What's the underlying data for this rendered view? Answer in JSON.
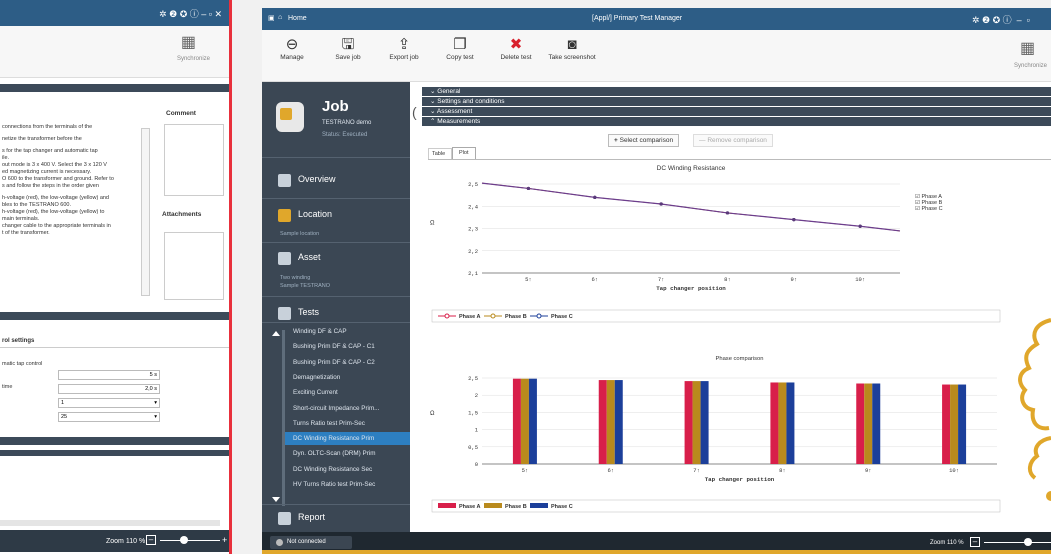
{
  "left": {
    "synchronize": "Synchronize",
    "comment": "Comment",
    "attachments": "Attachments",
    "instructions": [
      "connections from the terminals of the",
      "",
      "netize the transformer before the",
      "",
      "s for the tap changer and automatic tap",
      "ile.",
      "out mode is 3 x 400 V. Select the 3 x 120 V",
      "ed magnetizing current is necessary.",
      "O 600 to the transformer and ground. Refer to",
      "s and follow the steps in the order given",
      "",
      "h-voltage (red), the low-voltage (yellow) and",
      "bles to the TESTRANO 600.",
      "h-voltage (red), the low-voltage (yellow) to",
      "main terminals.",
      "changer cable to the appropriate terminals in",
      "t of the transformer."
    ],
    "control_title": "rol settings",
    "matic_label": "matic tap control",
    "time_label": "time",
    "values": [
      "5 s",
      "2,0 s",
      "1",
      "25"
    ],
    "zoom": "Zoom  110 %"
  },
  "right": {
    "home": "Home",
    "app_title": "[Appl/] Primary Test Manager",
    "toolbar": [
      {
        "label": "Manage",
        "icon": "arrow-left-icon"
      },
      {
        "label": "Save job",
        "icon": "save-icon"
      },
      {
        "label": "Export job",
        "icon": "export-icon"
      },
      {
        "label": "Copy test",
        "icon": "copy-icon"
      },
      {
        "label": "Delete test",
        "icon": "delete-icon"
      },
      {
        "label": "Take screenshot",
        "icon": "camera-icon"
      }
    ],
    "synchronize": "Synchronize",
    "job": {
      "title": "Job",
      "device": "TESTRANO demo",
      "status": "Status: Executed"
    },
    "nav": {
      "overview": "Overview",
      "location": "Location",
      "location_sub": "Sample location",
      "asset": "Asset",
      "asset_sub1": "Two winding",
      "asset_sub2": "Sample TESTRANO",
      "tests": "Tests",
      "report": "Report"
    },
    "tests": [
      "Winding DF & CAP",
      "Bushing Prim DF & CAP - C1",
      "Bushing Prim DF & CAP - C2",
      "Demagnetization",
      "Exciting Current",
      "Short-circuit Impedance Prim...",
      "Turns Ratio test Prim-Sec",
      "DC Winding Resistance Prim",
      "Dyn. OLTC-Scan (DRM) Prim",
      "DC Winding Resistance Sec",
      "HV Turns Ratio test Prim-Sec"
    ],
    "selected_test": "DC Winding Resistance Prim",
    "sections": [
      "General",
      "Settings and conditions",
      "Assessment",
      "Measurements"
    ],
    "buttons": {
      "select": "Select comparison",
      "remove": "Remove comparison"
    },
    "tabs": [
      "Table",
      "Plot"
    ],
    "checkboxes": [
      "Phase A",
      "Phase B",
      "Phase C"
    ],
    "not_connected": "Not connected",
    "zoom": "Zoom  110 %"
  },
  "colors": {
    "phase_a": "#d81f4a",
    "phase_b": "#b98a1d",
    "phase_c": "#1c3f9a",
    "accent_bar": "#e0a72b"
  },
  "chart_data": [
    {
      "type": "line",
      "title": "DC Winding Resistance",
      "xlabel": "Tap changer position",
      "ylabel": "Ω",
      "categories": [
        "5↑",
        "6↑",
        "7↑",
        "8↑",
        "9↑",
        "10↑"
      ],
      "ylim": [
        2.1,
        2.5
      ],
      "yticks": [
        "2,1",
        "2,2",
        "2,3",
        "2,4",
        "2,5"
      ],
      "series": [
        {
          "name": "Phase A",
          "values": [
            2.48,
            2.44,
            2.41,
            2.37,
            2.34,
            2.31
          ]
        },
        {
          "name": "Phase B",
          "values": [
            2.48,
            2.44,
            2.41,
            2.37,
            2.34,
            2.31
          ]
        },
        {
          "name": "Phase C",
          "values": [
            2.48,
            2.44,
            2.41,
            2.37,
            2.34,
            2.31
          ]
        }
      ]
    },
    {
      "type": "bar",
      "title": "Phase comparison",
      "xlabel": "Tap changer position",
      "ylabel": "Ω",
      "categories": [
        "5↑",
        "6↑",
        "7↑",
        "8↑",
        "9↑",
        "10↑"
      ],
      "ylim": [
        0,
        2.5
      ],
      "yticks": [
        "0",
        "0,5",
        "1",
        "1,5",
        "2",
        "2,5"
      ],
      "series": [
        {
          "name": "Phase A",
          "values": [
            2.48,
            2.44,
            2.41,
            2.37,
            2.34,
            2.31
          ]
        },
        {
          "name": "Phase B",
          "values": [
            2.48,
            2.44,
            2.41,
            2.37,
            2.34,
            2.31
          ]
        },
        {
          "name": "Phase C",
          "values": [
            2.48,
            2.44,
            2.41,
            2.37,
            2.34,
            2.31
          ]
        }
      ]
    }
  ]
}
